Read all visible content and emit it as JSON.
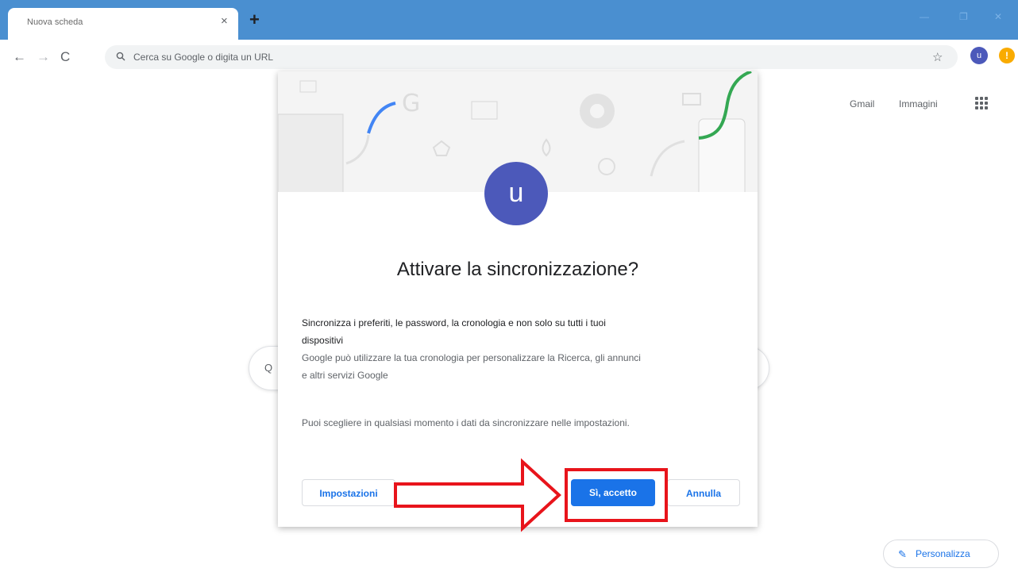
{
  "browser": {
    "tab_title": "Nuova scheda",
    "tab_close": "×",
    "new_tab": "+",
    "omnibox_placeholder": "Cerca su Google o digita un URL",
    "profile_initial": "u",
    "alert_glyph": "!"
  },
  "ntp": {
    "links": [
      "Gmail",
      "Immagini"
    ],
    "customize_label": "Personalizza"
  },
  "dialog": {
    "avatar_initial": "u",
    "title": "Attivare la sincronizzazione?",
    "line1": "Sincronizza i preferiti, le password, la cronologia e non solo su tutti i tuoi",
    "line2": "dispositivi",
    "line3": "Google può utilizzare la tua cronologia per personalizzare la Ricerca, gli annunci",
    "line4": "e altri servizi Google",
    "note": "Puoi scegliere in qualsiasi momento i dati da sincronizzare nelle impostazioni.",
    "btn_settings": "Impostazioni",
    "btn_accept": "Sì, accetto",
    "btn_cancel": "Annulla"
  },
  "colors": {
    "tabstrip": "#4a8fd0",
    "accent": "#1a73e8",
    "avatar": "#4c59ba",
    "annotation": "#e8141b"
  },
  "icons": [
    "back-icon",
    "forward-icon",
    "reload-icon",
    "search-icon",
    "star-icon",
    "apps-icon",
    "pencil-icon",
    "arrow-annotation"
  ]
}
